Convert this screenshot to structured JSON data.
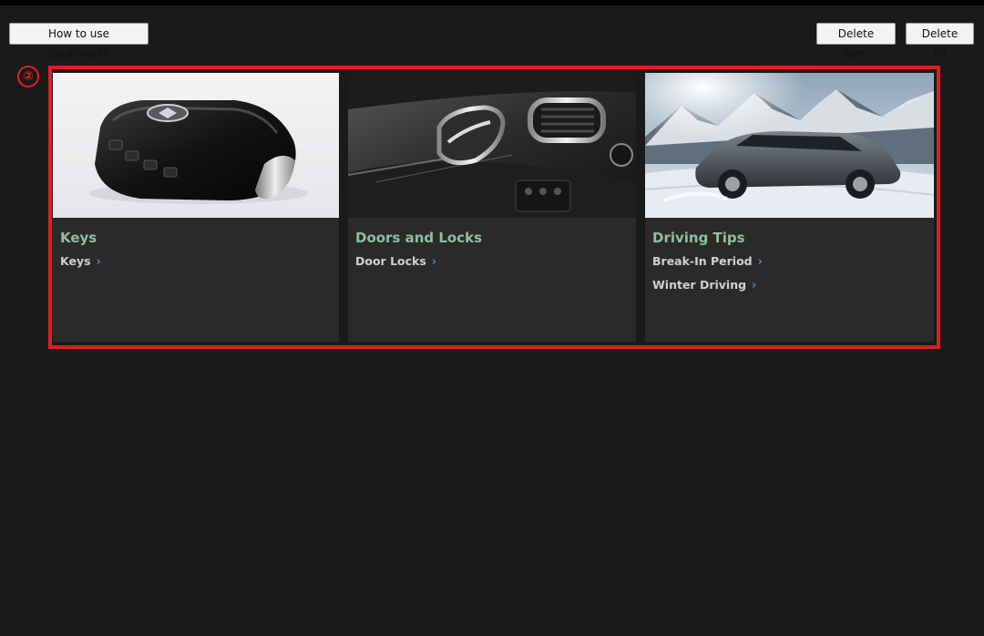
{
  "toolbar": {
    "howto_label": "How to use bookmarks",
    "delete_item_label": "Delete Item",
    "delete_all_label": "Delete All"
  },
  "annotation": {
    "marker": "②",
    "color": "#e01e1e"
  },
  "cards": [
    {
      "title": "Keys",
      "image": "smart-key-fob",
      "links": [
        {
          "label": "Keys",
          "icon": "chevron-right-icon"
        }
      ]
    },
    {
      "title": "Doors and Locks",
      "image": "car-door-interior",
      "links": [
        {
          "label": "Door Locks",
          "icon": "chevron-right-icon"
        }
      ]
    },
    {
      "title": "Driving Tips",
      "image": "suv-snowy-mountains",
      "links": [
        {
          "label": "Break-In Period",
          "icon": "chevron-right-icon"
        },
        {
          "label": "Winter Driving",
          "icon": "chevron-right-icon"
        }
      ]
    }
  ],
  "colors": {
    "background": "#1a1a1b",
    "card": "#2a2a2b",
    "title": "#8fbf9e",
    "link_chevron": "#2f8fdc"
  }
}
